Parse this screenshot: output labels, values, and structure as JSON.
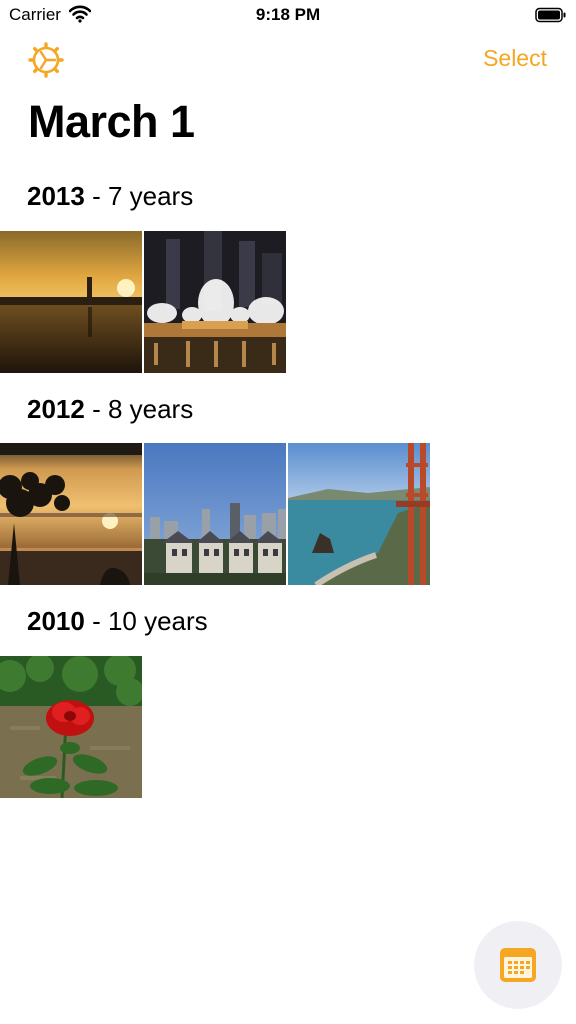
{
  "status_bar": {
    "carrier": "Carrier",
    "time": "9:18 PM",
    "icons": [
      "wifi-icon",
      "battery-icon"
    ]
  },
  "nav": {
    "settings_icon": "gear-icon",
    "select_label": "Select",
    "accent_color": "#f5a623"
  },
  "page_title": "March 1",
  "sections": [
    {
      "year": "2013",
      "ago": " - 7 years",
      "photos": [
        "sunset over lake",
        "fountain show at night"
      ]
    },
    {
      "year": "2012",
      "ago": " - 8 years",
      "photos": [
        "tree silhouette at sunset",
        "city houses with skyline",
        "golden gate coastline"
      ]
    },
    {
      "year": "2010",
      "ago": " - 10 years",
      "photos": [
        "red rose"
      ]
    }
  ],
  "floating_button": {
    "icon": "calendar-icon"
  }
}
